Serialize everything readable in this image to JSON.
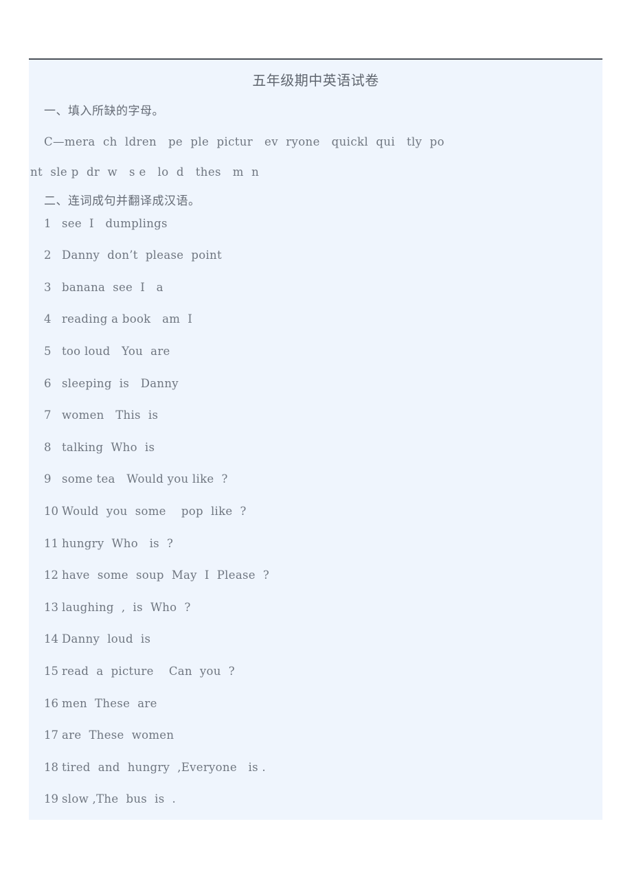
{
  "document": {
    "title": "五年级期中英语试卷",
    "sections": [
      {
        "heading": "一、填入所缺的字母。",
        "lines": [
          "C—mera  ch  ldren   pe  ple  pictur   ev  ryone   quickl  qui   tly  po",
          "nt  sle p  dr  w   s e   lo  d   thes   m  n"
        ]
      },
      {
        "heading": "二、连词成句并翻译成汉语。",
        "items": [
          {
            "num": "1",
            "text": "see  I   dumplings"
          },
          {
            "num": "2",
            "text": "Danny  don’t  please  point"
          },
          {
            "num": "3",
            "text": "banana  see  I   a"
          },
          {
            "num": "4",
            "text": "reading a book   am  I"
          },
          {
            "num": "5",
            "text": "too loud   You  are"
          },
          {
            "num": "6",
            "text": "sleeping  is   Danny"
          },
          {
            "num": "7",
            "text": "women   This  is"
          },
          {
            "num": "8",
            "text": "talking  Who  is"
          },
          {
            "num": "9",
            "text": "some tea   Would you like  ?"
          },
          {
            "num": "10",
            "text": "Would  you  some    pop  like  ?"
          },
          {
            "num": "11",
            "text": "hungry  Who   is  ?"
          },
          {
            "num": "12",
            "text": "have  some  soup  May  I  Please  ?"
          },
          {
            "num": "13",
            "text": "laughing  ,  is  Who  ?"
          },
          {
            "num": "14",
            "text": "Danny  loud  is"
          },
          {
            "num": "15",
            "text": "read  a  picture    Can  you  ?"
          },
          {
            "num": "16",
            "text": "men  These  are"
          },
          {
            "num": "17",
            "text": "are  These  women"
          },
          {
            "num": "18",
            "text": "tired  and  hungry  ,Everyone   is ."
          },
          {
            "num": "19",
            "text": "slow ,The  bus  is  ."
          }
        ]
      }
    ]
  },
  "colors": {
    "page_background": "#ffffff",
    "content_background": "#eff5fd",
    "text": "#6f7680",
    "rule": "#4a4f57"
  }
}
